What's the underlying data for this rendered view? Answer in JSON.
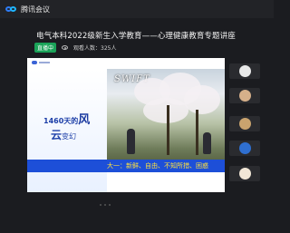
{
  "app": {
    "name": "腾讯会议"
  },
  "meeting": {
    "title": "电气本科2022级新生入学教育——心理健康教育专题讲座",
    "live_badge": "直播中",
    "viewers": "观看人数：325人"
  },
  "slide": {
    "headline_prefix": "1460天的",
    "headline_big": "风",
    "subline_big": "云",
    "subline_rest": "变幻",
    "photo_caption": "SWIFT",
    "banner": "大一：新鲜、自由、不知所措、困惑"
  },
  "participants": [
    {
      "avatar_color": "#e8e8e8"
    },
    {
      "avatar_color": "#d6b08a"
    },
    {
      "avatar_color": "#c9a36e"
    },
    {
      "avatar_color": "#2f6fd0"
    },
    {
      "avatar_color": "#f1e6d6"
    }
  ],
  "colors": {
    "accent": "#2e7cf6",
    "live": "#1aa358",
    "banner": "#1d4fd8",
    "banner_text": "#ffe23f"
  }
}
